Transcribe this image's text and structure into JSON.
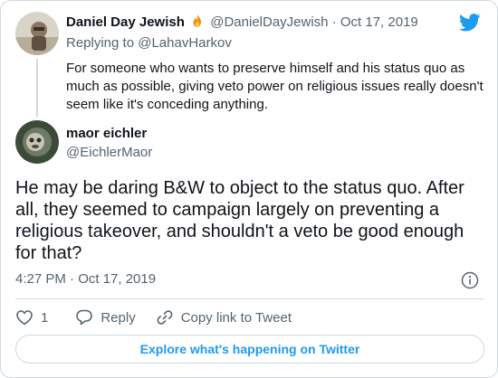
{
  "parent_tweet": {
    "author_name": "Daniel Day Jewish",
    "author_handle": "@DanielDayJewish",
    "separator": "·",
    "date": "Oct 17, 2019",
    "replying_prefix": "Replying to",
    "replying_to": "@LahavHarkov",
    "text": "For someone who wants to preserve himself and his status quo as much as possible, giving veto power on religious issues really doesn't seem like it's conceding anything.",
    "name_emoji_icon": "fire-icon"
  },
  "main_tweet": {
    "author_name": "maor eichler",
    "author_handle": "@EichlerMaor",
    "text": "He may be daring B&W to object to the status quo. After all, they seemed to campaign largely on preventing a religious takeover, and shouldn't a veto be good enough for that?",
    "timestamp": "4:27 PM · Oct 17, 2019"
  },
  "actions": {
    "like_count": "1",
    "reply_label": "Reply",
    "copy_link_label": "Copy link to Tweet"
  },
  "explore_label": "Explore what's happening on Twitter",
  "colors": {
    "twitter_blue": "#1d9bf0",
    "text_primary": "#0f1419",
    "text_secondary": "#536471",
    "border": "#cfd9de"
  }
}
